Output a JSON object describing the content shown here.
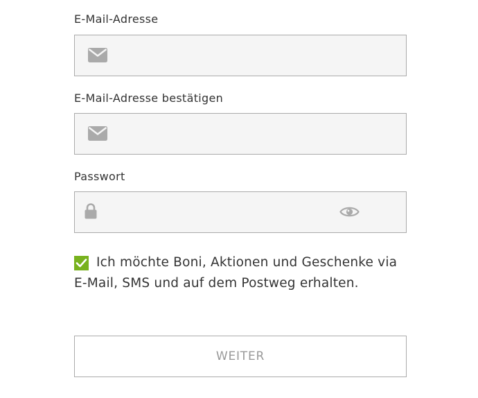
{
  "fields": {
    "email": {
      "label": "E-Mail-Adresse",
      "value": "",
      "icon": "envelope-icon"
    },
    "email_confirm": {
      "label": "E-Mail-Adresse bestätigen",
      "value": "",
      "icon": "envelope-icon"
    },
    "password": {
      "label": "Passwort",
      "value": "",
      "icon": "lock-icon",
      "toggle_icon": "eye-icon"
    }
  },
  "consent": {
    "checked": true,
    "text": "Ich möchte Boni, Aktionen und Geschenke via E-Mail, SMS und auf dem Postweg erhalten."
  },
  "submit": {
    "label": "WEITER"
  },
  "colors": {
    "accent_green": "#78b21e",
    "field_background": "#f5f5f5",
    "border": "#aaaaaa",
    "icon_gray": "#aaaaaa",
    "button_text": "#999999"
  }
}
